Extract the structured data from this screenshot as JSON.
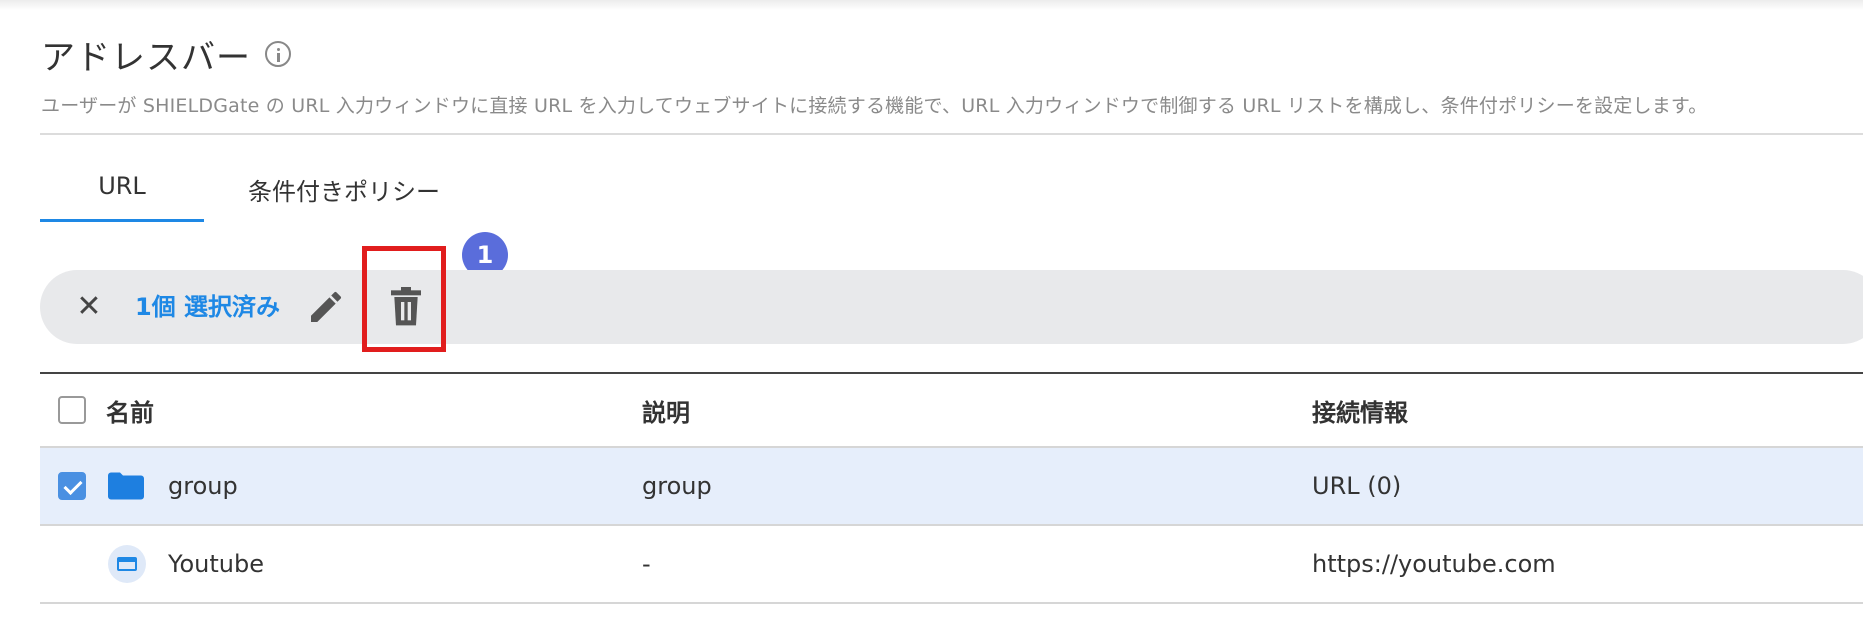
{
  "header": {
    "title": "アドレスバー",
    "description": "ユーザーが SHIELDGate の URL 入力ウィンドウに直接 URL を入力してウェブサイトに接続する機能で、URL 入力ウィンドウで制御する URL リストを構成し、条件付ポリシーを設定します。"
  },
  "tabs": [
    {
      "label": "URL",
      "active": true
    },
    {
      "label": "条件付きポリシー",
      "active": false
    }
  ],
  "annotation": {
    "badge": "1"
  },
  "selection_bar": {
    "close_glyph": "✕",
    "selected_text": "1個 選択済み"
  },
  "table": {
    "columns": [
      "名前",
      "説明",
      "接続情報"
    ],
    "rows": [
      {
        "name": "group",
        "description": "group",
        "connection": "URL (0)",
        "type": "folder",
        "checked": true
      },
      {
        "name": "Youtube",
        "description": "-",
        "connection": "https://youtube.com",
        "type": "url",
        "checked": false
      }
    ]
  },
  "colors": {
    "accent": "#1e88e5",
    "selected_row": "#e6eefb",
    "annotation_badge": "#5a6ddb",
    "highlight_box": "#e11d1d"
  },
  "icons": {
    "info": "info-icon",
    "close": "close-icon",
    "edit": "pencil-icon",
    "delete": "trash-icon",
    "folder": "folder-icon",
    "url": "browser-window-icon"
  }
}
